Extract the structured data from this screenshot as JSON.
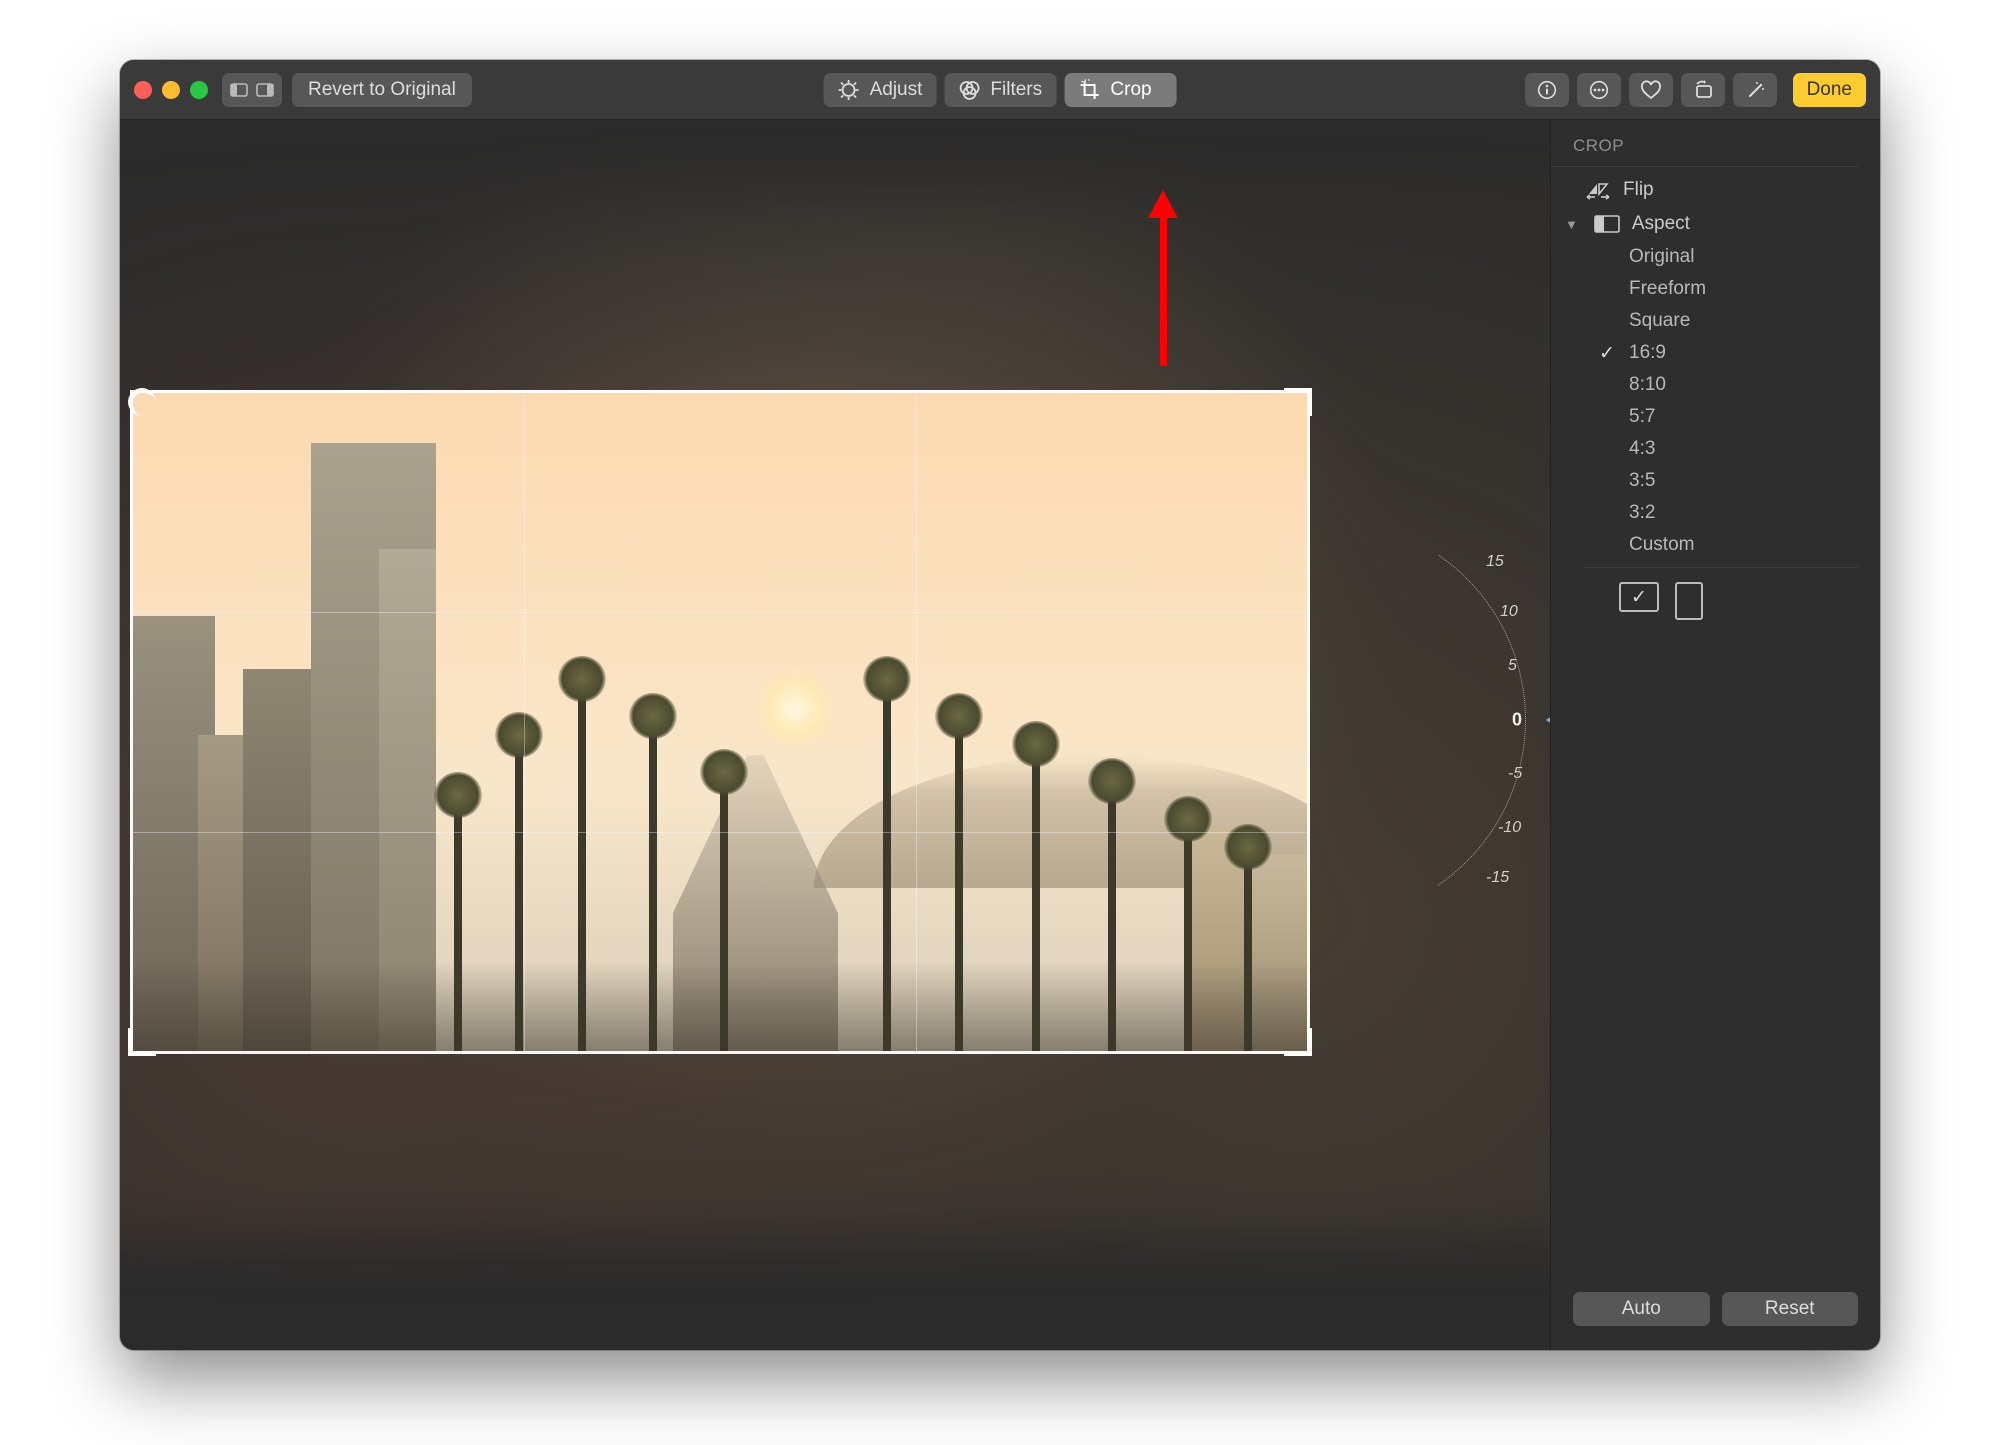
{
  "toolbar": {
    "revert_label": "Revert to Original",
    "tabs": {
      "adjust": "Adjust",
      "filters": "Filters",
      "crop": "Crop"
    },
    "done_label": "Done"
  },
  "annotation": {
    "arrow_color": "#ff0000"
  },
  "rotation_dial": {
    "ticks": [
      "15",
      "10",
      "5",
      "0",
      "-5",
      "-10",
      "-15"
    ],
    "value": 0
  },
  "sidebar": {
    "title": "CROP",
    "flip_label": "Flip",
    "aspect_label": "Aspect",
    "aspect_options": [
      "Original",
      "Freeform",
      "Square",
      "16:9",
      "8:10",
      "5:7",
      "4:3",
      "3:5",
      "3:2",
      "Custom"
    ],
    "aspect_selected": "16:9",
    "orientation_selected": "landscape",
    "auto_label": "Auto",
    "reset_label": "Reset"
  }
}
